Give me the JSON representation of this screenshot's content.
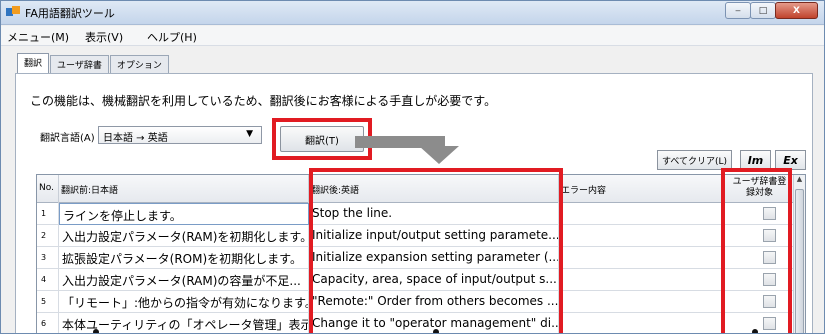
{
  "window": {
    "title": "FA用語翻訳ツール",
    "controls": {
      "minimize": "‒",
      "maximize": "□",
      "close": "X"
    }
  },
  "menu": [
    "メニュー(M)",
    "表示(V)",
    "ヘルプ(H)"
  ],
  "tabs": [
    "翻訳",
    "ユーザ辞書",
    "オプション"
  ],
  "description": "この機能は、機械翻訳を利用しているため、翻訳後にお客様による手直しが必要です。",
  "language": {
    "label": "翻訳言語(A)",
    "selected": "日本語 → 英語"
  },
  "buttons": {
    "translate": "翻訳(T)",
    "clear_all": "すべてクリア(L)",
    "import": "Im",
    "export": "Ex"
  },
  "table": {
    "columns": {
      "no": "No.",
      "source": "翻訳前:日本語",
      "target": "翻訳後:英語",
      "error": "エラー内容",
      "register": "ユーザ辞書登録対象"
    },
    "rows": [
      {
        "no": "1",
        "source": "ラインを停止します。",
        "target": "Stop the line.",
        "error": ""
      },
      {
        "no": "2",
        "source": "入出力設定パラメータ(RAM)を初期化します。",
        "target": "Initialize input/output setting paramete...",
        "error": ""
      },
      {
        "no": "3",
        "source": "拡張設定パラメータ(ROM)を初期化します。",
        "target": "Initialize expansion setting parameter (...",
        "error": ""
      },
      {
        "no": "4",
        "source": "入出力設定パラメータ(RAM)の容量が不足...",
        "target": "Capacity, area, space of input/output s...",
        "error": ""
      },
      {
        "no": "5",
        "source": "「リモート」:他からの指令が有効になります。",
        "target": "\"Remote:\" Order from others becomes ...",
        "error": ""
      },
      {
        "no": "6",
        "source": "本体ユーティリティの「オペレータ管理」表示に...",
        "target": "Change it to \"operator management\" di...",
        "error": ""
      }
    ]
  },
  "colors": {
    "highlight": "#e11b22",
    "arrow": "#8c8c8c"
  }
}
